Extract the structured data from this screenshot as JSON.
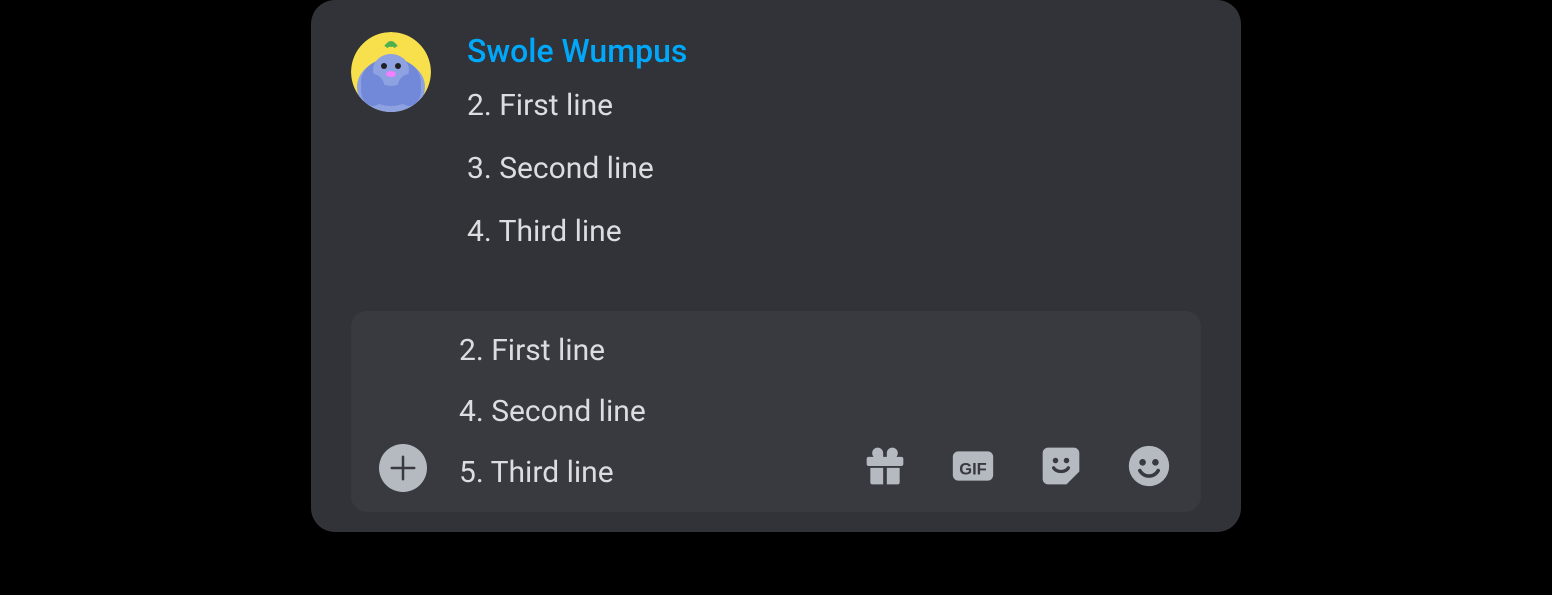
{
  "message": {
    "username": "Swole Wumpus",
    "lines": [
      "2. First line",
      "3. Second line",
      "4. Third line"
    ]
  },
  "input": {
    "lines": [
      "2. First line",
      "4. Second line",
      "5. Third line"
    ]
  },
  "icons": {
    "plus": "plus-icon",
    "gift": "gift-icon",
    "gif": "gif-icon",
    "sticker": "sticker-icon",
    "emoji": "emoji-icon"
  },
  "colors": {
    "username": "#00A8FC",
    "text": "#DBDEE1",
    "panel": "#313338",
    "inputBg": "#383A40",
    "iconGray": "#B5BAC1"
  }
}
